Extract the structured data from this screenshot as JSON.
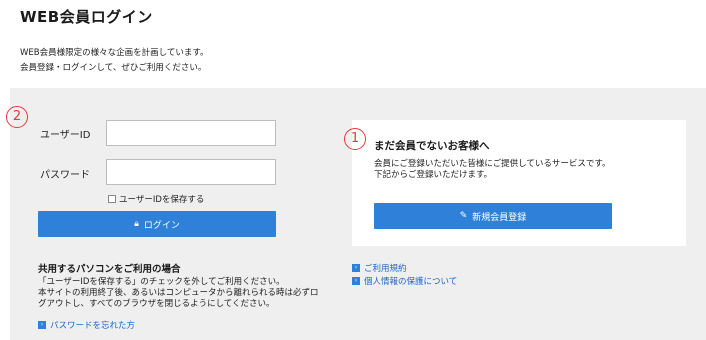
{
  "header": {
    "title": "WEB会員ログイン",
    "intro_line1": "WEB会員様限定の様々な企画を計画しています。",
    "intro_line2": "会員登録・ログインして、ぜひご利用ください。"
  },
  "login": {
    "badge": "2",
    "userid_label": "ユーザーID",
    "userid_value": "",
    "password_label": "パスワード",
    "password_value": "",
    "remember_label": "ユーザーIDを保存する",
    "login_icon": "lock-icon",
    "login_button": "ログイン",
    "shared_pc_heading": "共用するパソコンをご利用の場合",
    "shared_pc_note_line1": "「ユーザーIDを保存する」のチェックを外してご利用ください。",
    "shared_pc_note_line2": "本サイトの利用終了後、あるいはコンピュータから離れられる時は必ずロ",
    "shared_pc_note_line3": "グアウトし、すべてのブラウザを閉じるようにしてください。",
    "forgot_password_link": "パスワードを忘れた方"
  },
  "register": {
    "badge": "1",
    "title": "まだ会員でないお客様へ",
    "text_line1": "会員にご登録いただいた皆様にご提供しているサービスです。",
    "text_line2": "下記からご登録いただけます。",
    "register_icon": "edit-icon",
    "register_button": "新規会員登録",
    "terms_link": "ご利用規約",
    "privacy_link": "個人情報の保護について"
  },
  "colors": {
    "accent": "#2e80d8",
    "badge": "#e8383d",
    "panel_bg": "#efefef",
    "link": "#1a66c8"
  }
}
